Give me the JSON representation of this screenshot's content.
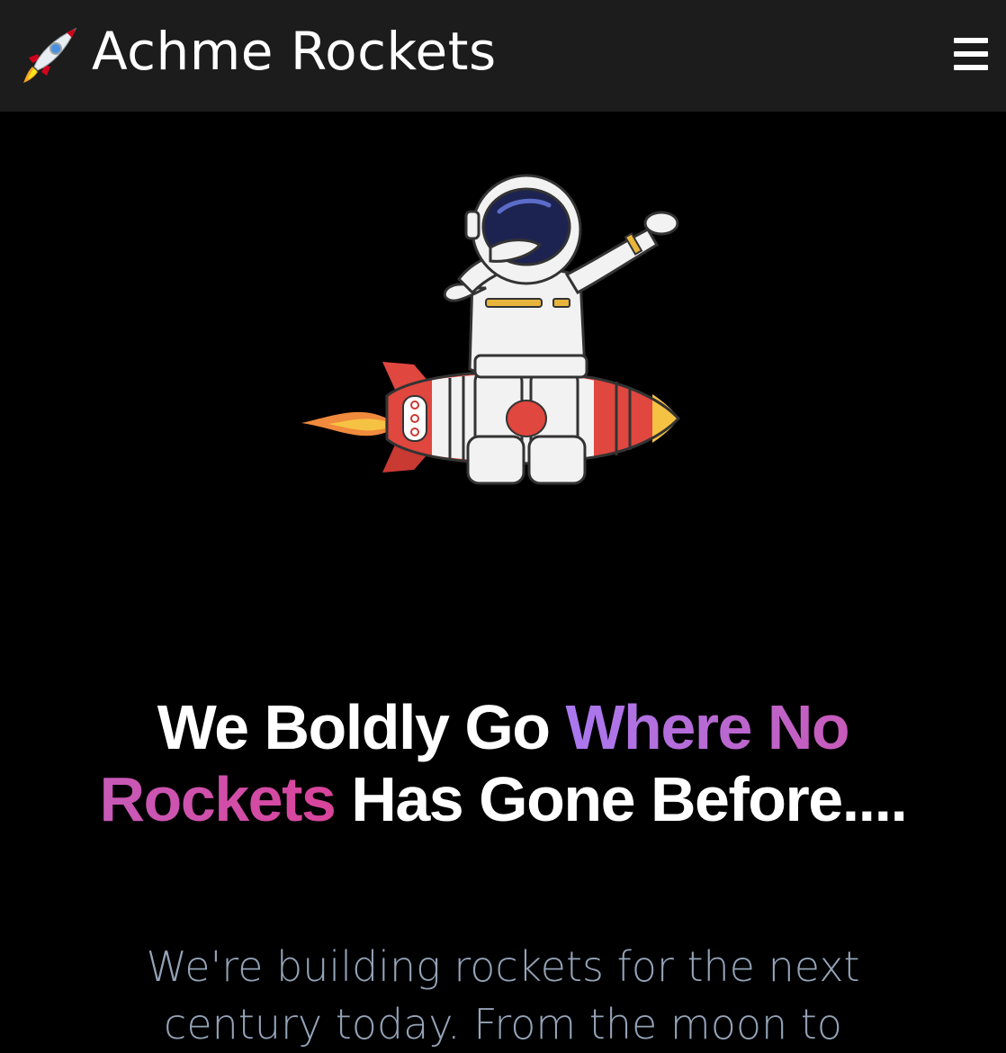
{
  "nav": {
    "logo_icon": "rocket-icon",
    "brand_name": "Achme Rockets",
    "menu_icon": "hamburger-menu-icon"
  },
  "hero": {
    "image": "astronaut-on-rocket-illustration",
    "headline_part1": "We Boldly Go ",
    "headline_highlight": "Where No Rockets",
    "headline_part2": " Has Gone Before....",
    "subtitle": "We're building rockets for the next century today. From the moon to"
  },
  "colors": {
    "navbar_bg": "#1c1c1c",
    "page_bg": "#000000",
    "gradient_start": "#a979f0",
    "gradient_end": "#d9449a",
    "subtitle": "#94a3b8"
  }
}
